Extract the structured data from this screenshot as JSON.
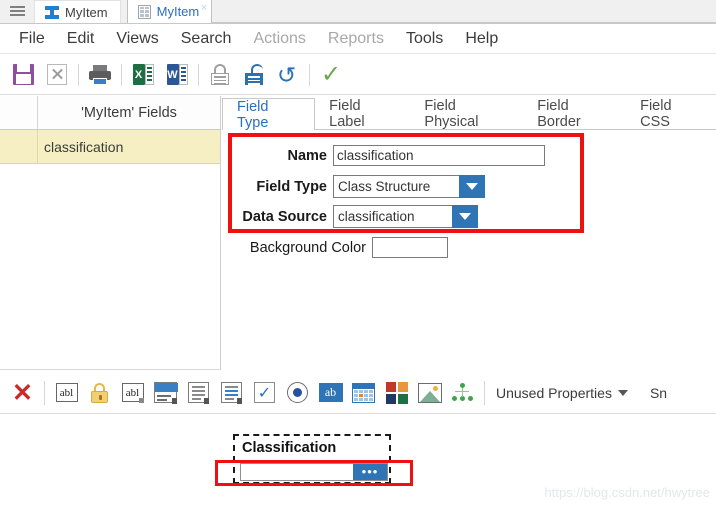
{
  "tabstrip": {
    "menu_icon": "hamburger-icon",
    "tabs": [
      {
        "label": "MyItem",
        "icon": "ibeam-icon",
        "active": false
      },
      {
        "label": "MyItem",
        "icon": "grid-form-icon",
        "active": true,
        "close": "×"
      }
    ]
  },
  "menubar": {
    "items": [
      {
        "label": "File",
        "disabled": false
      },
      {
        "label": "Edit",
        "disabled": false
      },
      {
        "label": "Views",
        "disabled": false
      },
      {
        "label": "Search",
        "disabled": false
      },
      {
        "label": "Actions",
        "disabled": true
      },
      {
        "label": "Reports",
        "disabled": true
      },
      {
        "label": "Tools",
        "disabled": false
      },
      {
        "label": "Help",
        "disabled": false
      }
    ]
  },
  "toolbar": {
    "buttons": [
      {
        "name": "save-icon"
      },
      {
        "name": "delete-icon"
      },
      {
        "name": "print-icon"
      },
      {
        "name": "export-excel-icon"
      },
      {
        "name": "export-word-icon"
      },
      {
        "name": "lock-icon"
      },
      {
        "name": "unlock-icon"
      },
      {
        "name": "undo-icon",
        "glyph": "↺"
      },
      {
        "name": "confirm-check-icon",
        "glyph": "✓"
      }
    ]
  },
  "left_panel": {
    "header": "'MyItem' Fields",
    "rows": [
      {
        "label": "classification",
        "selected": true
      }
    ]
  },
  "field_tabs": [
    {
      "label": "Field Type",
      "active": true
    },
    {
      "label": "Field Label",
      "active": false
    },
    {
      "label": "Field Physical",
      "active": false
    },
    {
      "label": "Field Border",
      "active": false
    },
    {
      "label": "Field CSS",
      "active": false
    }
  ],
  "form": {
    "name": {
      "label": "Name",
      "value": "classification"
    },
    "field_type": {
      "label": "Field Type",
      "value": "Class Structure"
    },
    "data_source": {
      "label": "Data Source",
      "value": "classification"
    },
    "background_color": {
      "label": "Background Color",
      "value": ""
    },
    "highlight_color": "#ee1111"
  },
  "bottom_toolbar": {
    "buttons": [
      {
        "name": "remove-field-icon",
        "glyph": "✕"
      },
      {
        "name": "text-field-icon",
        "glyph": "abl"
      },
      {
        "name": "password-field-icon",
        "glyph": "padlock"
      },
      {
        "name": "textarea-field-icon",
        "glyph": "abl"
      },
      {
        "name": "form-group-icon"
      },
      {
        "name": "list-box-icon"
      },
      {
        "name": "rich-list-icon"
      },
      {
        "name": "checkbox-field-icon",
        "glyph": "✓"
      },
      {
        "name": "radio-field-icon"
      },
      {
        "name": "label-field-icon",
        "glyph": "ab"
      },
      {
        "name": "date-field-icon"
      },
      {
        "name": "color-field-icon"
      },
      {
        "name": "image-field-icon"
      },
      {
        "name": "relation-tree-icon"
      }
    ],
    "unused_properties": {
      "label": "Unused Properties",
      "caret": "▼"
    },
    "trailing_text": "Sn"
  },
  "preview": {
    "widget_label": "Classification",
    "browse_button": "•••",
    "input_value": "",
    "highlight_color": "#ee1111"
  },
  "watermark": "https://blog.csdn.net/hwytree"
}
